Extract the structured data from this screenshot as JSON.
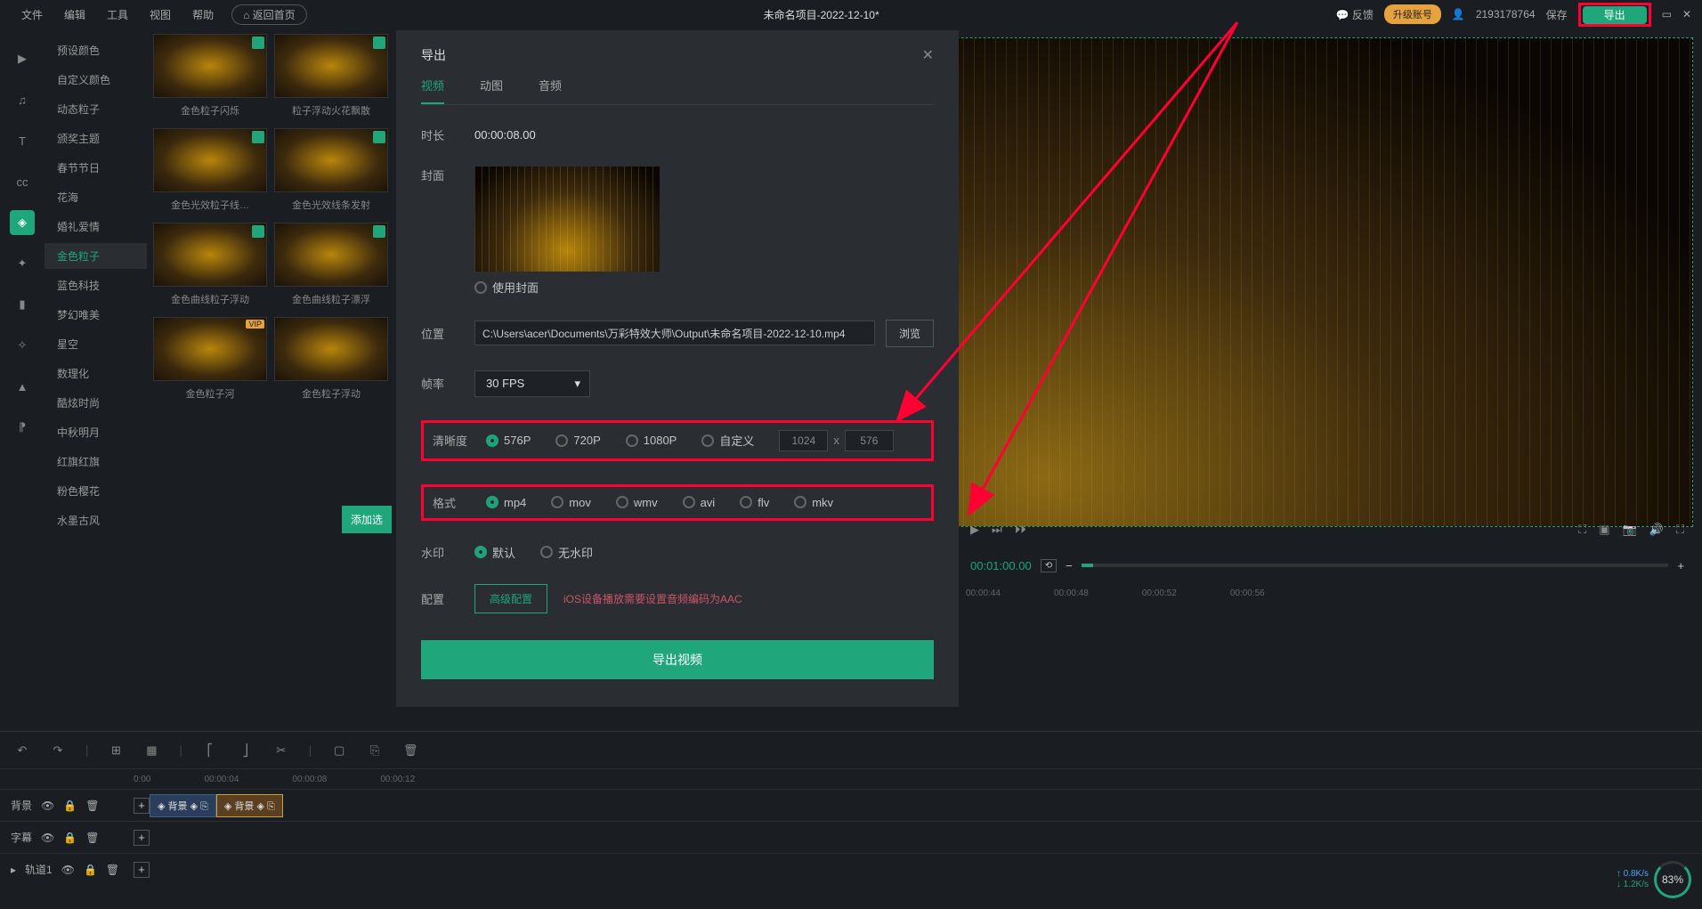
{
  "topbar": {
    "menus": [
      "文件",
      "编辑",
      "工具",
      "视图",
      "帮助"
    ],
    "home": "返回首页",
    "title": "未命名项目-2022-12-10*",
    "feedback": "反馈",
    "upgrade": "升级账号",
    "user_id": "2193178764",
    "save": "保存",
    "export": "导出"
  },
  "sidebar_categories": [
    "预设颜色",
    "自定义颜色",
    "动态粒子",
    "颁奖主题",
    "春节节日",
    "花海",
    "婚礼爱情",
    "金色粒子",
    "蓝色科技",
    "梦幻唯美",
    "星空",
    "数理化",
    "酷炫时尚",
    "中秋明月",
    "红旗红旗",
    "粉色樱花",
    "水墨古风"
  ],
  "sidebar_active_index": 7,
  "thumbs": [
    {
      "label": "金色粒子闪烁",
      "tag": "dl"
    },
    {
      "label": "粒子浮动火花飘散",
      "tag": "dl"
    },
    {
      "label": "金色光效粒子线…",
      "tag": "dl"
    },
    {
      "label": "金色光效线条发射",
      "tag": "dl"
    },
    {
      "label": "金色曲线粒子浮动",
      "tag": "dl"
    },
    {
      "label": "金色曲线粒子漂浮",
      "tag": "dl"
    },
    {
      "label": "金色粒子河",
      "tag": "vip"
    },
    {
      "label": "金色粒子浮动",
      "tag": ""
    }
  ],
  "add_selected": "添加选",
  "modal": {
    "title": "导出",
    "tabs": [
      "视频",
      "动图",
      "音频"
    ],
    "active_tab": 0,
    "duration_label": "时长",
    "duration_value": "00:00:08.00",
    "cover_label": "封面",
    "use_cover": "使用封面",
    "location_label": "位置",
    "path": "C:\\Users\\acer\\Documents\\万彩特效大师\\Output\\未命名项目-2022-12-10.mp4",
    "browse": "浏览",
    "fps_label": "帧率",
    "fps_value": "30 FPS",
    "resolution_label": "清晰度",
    "resolutions": [
      "576P",
      "720P",
      "1080P",
      "自定义"
    ],
    "resolution_selected": 0,
    "dim_w": "1024",
    "dim_h": "576",
    "dim_sep": "x",
    "format_label": "格式",
    "formats": [
      "mp4",
      "mov",
      "wmv",
      "avi",
      "flv",
      "mkv"
    ],
    "format_selected": 0,
    "watermark_label": "水印",
    "watermark_options": [
      "默认",
      "无水印"
    ],
    "watermark_selected": 0,
    "config_label": "配置",
    "advanced": "高级配置",
    "hint": "iOS设备播放需要设置音频编码为AAC",
    "export_button": "导出视频"
  },
  "playback": {
    "current_time": "00:01:00.00"
  },
  "timeline": {
    "ruler_left": [
      "0:00",
      "00:00:04",
      "00:00:08",
      "00:00:12"
    ],
    "ruler_right": [
      "00:00:44",
      "00:00:48",
      "00:00:52",
      "00:00:56"
    ],
    "tracks": [
      {
        "name": "背景",
        "clips": [
          "背景",
          "背景"
        ]
      },
      {
        "name": "字幕",
        "clips": []
      },
      {
        "name": "轨道1",
        "clips": []
      }
    ]
  },
  "netspeed": {
    "up": "0.8K/s",
    "down": "1.2K/s",
    "pct": "83%"
  }
}
